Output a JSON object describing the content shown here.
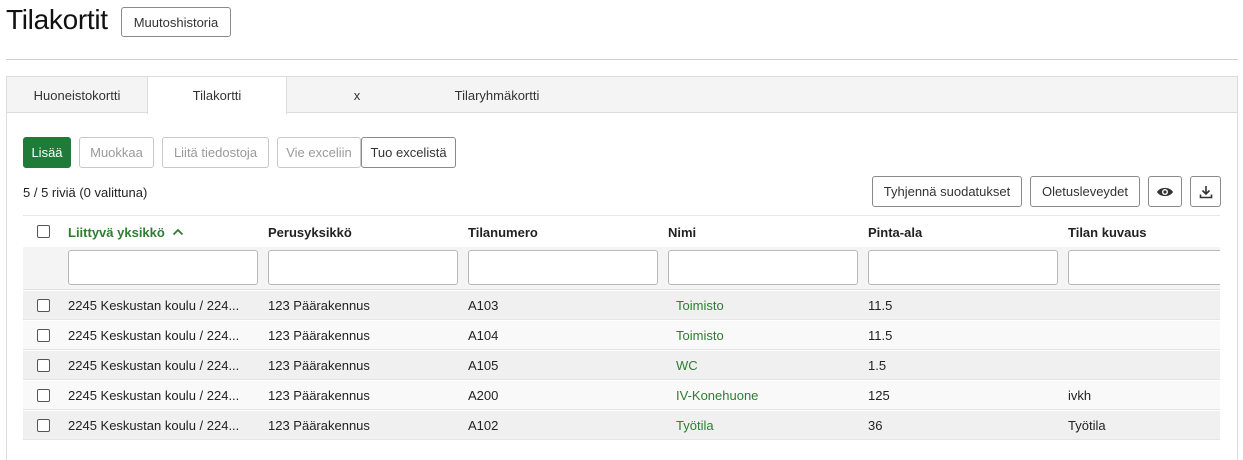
{
  "page": {
    "title": "Tilakortit",
    "history_button": "Muutoshistoria"
  },
  "tabs": [
    {
      "label": "Huoneistokortti",
      "active": false
    },
    {
      "label": "Tilakortti",
      "active": true
    },
    {
      "label": "x",
      "active": false
    },
    {
      "label": "Tilaryhmäkortti",
      "active": false
    }
  ],
  "toolbar": {
    "add": "Lisää",
    "edit": "Muokkaa",
    "attach": "Liitä tiedostoja",
    "export": "Vie exceliin",
    "import": "Tuo excelistä"
  },
  "status": {
    "row_count": "5 / 5 riviä (0 valittuna)"
  },
  "grid_tools": {
    "clear_filters": "Tyhjennä suodatukset",
    "default_widths": "Oletusleveydet",
    "visibility_icon": "eye-icon",
    "download_icon": "download-icon"
  },
  "columns": [
    {
      "label": "Liittyvä yksikkö",
      "sorted": "asc"
    },
    {
      "label": "Perusyksikkö"
    },
    {
      "label": "Tilanumero"
    },
    {
      "label": "Nimi"
    },
    {
      "label": "Pinta-ala"
    },
    {
      "label": "Tilan kuvaus"
    }
  ],
  "rows": [
    {
      "unit": "2245 Keskustan koulu / 224...",
      "base": "123 Päärakennus",
      "number": "A103",
      "name": "Toimisto",
      "area": "11.5",
      "desc": ""
    },
    {
      "unit": "2245 Keskustan koulu / 224...",
      "base": "123 Päärakennus",
      "number": "A104",
      "name": "Toimisto",
      "area": "11.5",
      "desc": ""
    },
    {
      "unit": "2245 Keskustan koulu / 224...",
      "base": "123 Päärakennus",
      "number": "A105",
      "name": "WC",
      "area": "1.5",
      "desc": ""
    },
    {
      "unit": "2245 Keskustan koulu / 224...",
      "base": "123 Päärakennus",
      "number": "A200",
      "name": "IV-Konehuone",
      "area": "125",
      "desc": "ivkh"
    },
    {
      "unit": "2245 Keskustan koulu / 224...",
      "base": "123 Päärakennus",
      "number": "A102",
      "name": "Työtila",
      "area": "36",
      "desc": "Työtila"
    }
  ],
  "colors": {
    "accent": "#1e7b38",
    "link": "#2e7d32"
  }
}
